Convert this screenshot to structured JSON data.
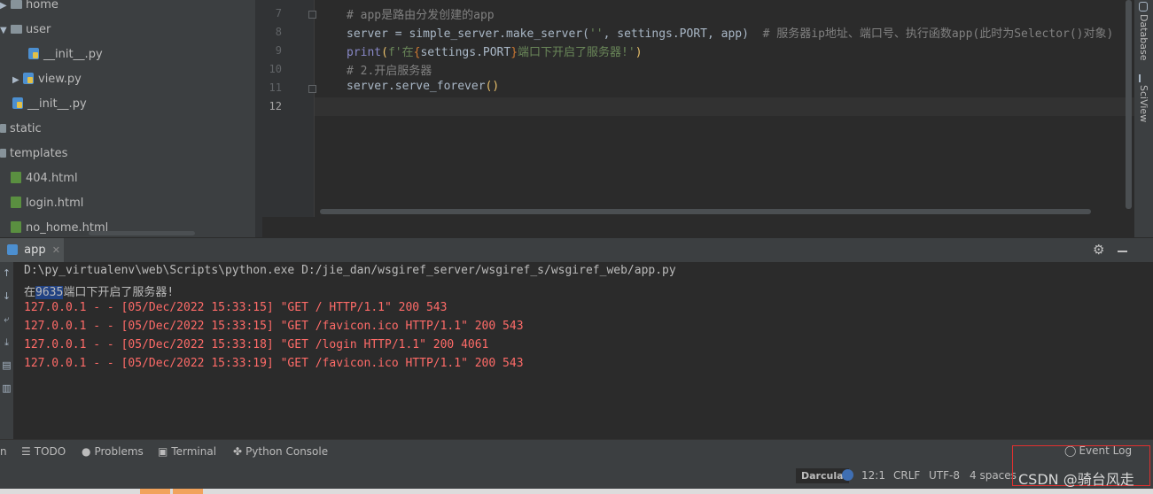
{
  "project_tree": {
    "items": [
      {
        "label": "home",
        "type": "folder",
        "expanded": false
      },
      {
        "label": "user",
        "type": "folder",
        "expanded": true
      },
      {
        "label": "__init__.py",
        "type": "py"
      },
      {
        "label": "view.py",
        "type": "py",
        "expanded": false
      },
      {
        "label": "__init__.py",
        "type": "py"
      },
      {
        "label": "static",
        "type": "folder"
      },
      {
        "label": "templates",
        "type": "folder"
      },
      {
        "label": "404.html",
        "type": "html"
      },
      {
        "label": "login.html",
        "type": "html"
      },
      {
        "label": "no_home.html",
        "type": "html"
      }
    ]
  },
  "editor": {
    "line_numbers": [
      "7",
      "8",
      "9",
      "10",
      "11",
      "12"
    ],
    "lines": {
      "l7": "# app是路由分发创建的app",
      "l8_a": "server = simple_server.make_server(",
      "l8_b": "''",
      "l8_c": ", settings.PORT, app)",
      "l8_d": "  # 服务器ip地址、端口号、执行函数app(此时为Selector()对象)",
      "l9_a": "print",
      "l9_b": "(",
      "l9_c": "f'在",
      "l9_d": "{",
      "l9_e": "settings.PORT",
      "l9_f": "}",
      "l9_g": "端口下开启了服务器!'",
      "l9_h": ")",
      "l10": "# 2.开启服务器",
      "l11_a": "server.serve_forever",
      "l11_b": "()"
    }
  },
  "right_tool_tabs": [
    "Database",
    "SciView"
  ],
  "run_panel": {
    "tab_label": "app",
    "lines": {
      "cmd": "D:\\py_virtualenv\\web\\Scripts\\python.exe D:/jie_dan/wsgiref_server/wsgiref_s/wsgiref_web/app.py",
      "start_pre": "在",
      "start_port": "9635",
      "start_post": "端口下开启了服务器!",
      "log1": "127.0.0.1 - - [05/Dec/2022 15:33:15] \"GET / HTTP/1.1\" 200 543",
      "log2": "127.0.0.1 - - [05/Dec/2022 15:33:15] \"GET /favicon.ico HTTP/1.1\" 200 543",
      "log3": "127.0.0.1 - - [05/Dec/2022 15:33:18] \"GET /login HTTP/1.1\" 200 4061",
      "log4": "127.0.0.1 - - [05/Dec/2022 15:33:19] \"GET /favicon.ico HTTP/1.1\" 200 543"
    }
  },
  "bottom_tabs": {
    "run_partial": "n",
    "todo": "TODO",
    "problems": "Problems",
    "terminal": "Terminal",
    "python_console": "Python Console",
    "event_log": "Event Log"
  },
  "status_bar": {
    "theme": "Darcula",
    "caret": "12:1",
    "line_sep": "CRLF",
    "encoding": "UTF-8",
    "indent": "4 spaces"
  },
  "watermark": "CSDN @骑台风走",
  "colors": {
    "error_text": "#ff6b68",
    "comment": "#808080",
    "string": "#6a8759",
    "keyword": "#cc7832"
  }
}
